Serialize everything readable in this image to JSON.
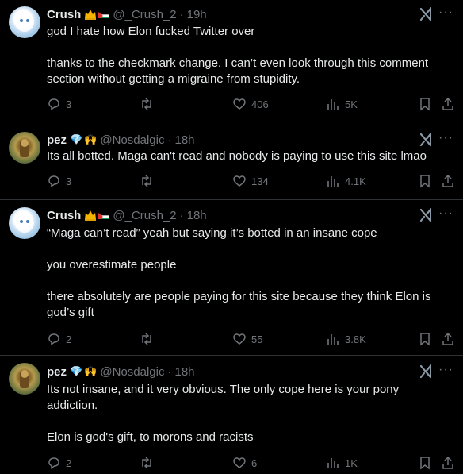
{
  "tweets": [
    {
      "name": "Crush",
      "badges": [
        "crown",
        "palestine-flag"
      ],
      "handle": "@_Crush_2",
      "time": "19h",
      "lines": [
        "god I hate how Elon fucked Twitter over",
        "",
        "thanks to the checkmark change. I can’t even look through this comment",
        "section without getting a migraine from stupidity."
      ],
      "replies": "3",
      "likes": "406",
      "views": "5K"
    },
    {
      "name": "pez",
      "badges": [
        "💎",
        "🙌"
      ],
      "handle": "@Nosdalgic",
      "time": "18h",
      "lines": [
        "Its all botted. Maga can't read and nobody is paying to use this site lmao"
      ],
      "replies": "3",
      "likes": "134",
      "views": "4.1K"
    },
    {
      "name": "Crush",
      "badges": [
        "crown",
        "palestine-flag"
      ],
      "handle": "@_Crush_2",
      "time": "18h",
      "lines": [
        "“Maga can’t read” yeah but saying it’s botted in an insane cope",
        "",
        "you overestimate people",
        "",
        "there absolutely are people paying for this site because they think Elon is",
        "god’s gift"
      ],
      "replies": "2",
      "likes": "55",
      "views": "3.8K"
    },
    {
      "name": "pez",
      "badges": [
        "💎",
        "🙌"
      ],
      "handle": "@Nosdalgic",
      "time": "18h",
      "lines": [
        "Its not insane, and it very obvious. The only cope here is your pony",
        "addiction.",
        "",
        "Elon is god's gift, to morons and racists"
      ],
      "replies": "2",
      "likes": "6",
      "views": "1K"
    }
  ],
  "ui": {
    "dot": "·",
    "more": "···"
  },
  "colors": {
    "text": "#e7e9ea",
    "secondary": "#71767b",
    "background": "#000000",
    "divider": "#2f3336"
  }
}
